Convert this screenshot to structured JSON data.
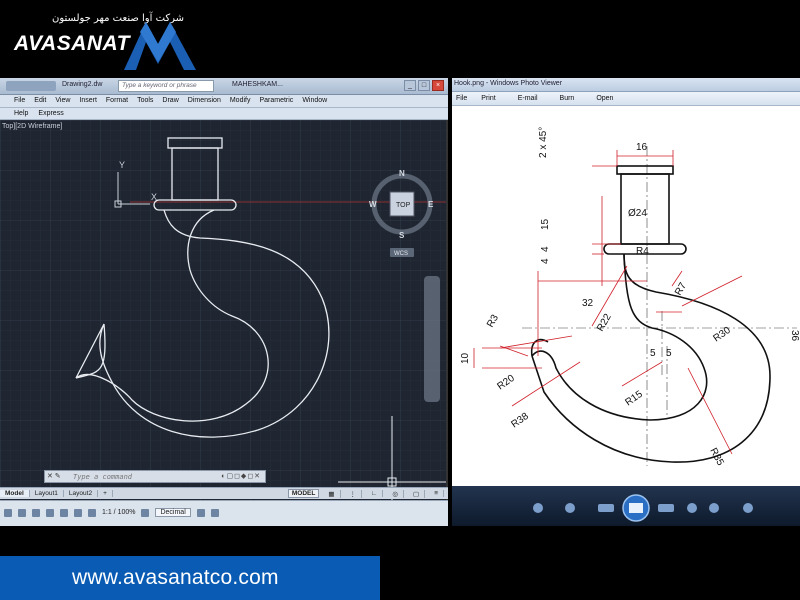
{
  "logo": {
    "persian": "شرکت آوا صنعت مهر جولستون",
    "word": "AVASANAT"
  },
  "autocad": {
    "doc_tab": "Drawing2.dw",
    "search_placeholder": "Type a keyword or phrase",
    "user": "MAHESHKAM...",
    "menu": [
      "File",
      "Edit",
      "View",
      "Insert",
      "Format",
      "Tools",
      "Draw",
      "Dimension",
      "Modify",
      "Parametric",
      "Window"
    ],
    "menu2": [
      "Help",
      "Express"
    ],
    "viewport_label": "Top][2D Wireframe]",
    "viewcube": {
      "top": "TOP",
      "n": "N",
      "s": "S",
      "e": "E",
      "w": "W",
      "wcs": "WCS"
    },
    "ucs": {
      "x": "X",
      "y": "Y"
    },
    "command_placeholder": "Type a command",
    "layout_tabs": [
      "Model",
      "Layout1",
      "Layout2",
      "+"
    ],
    "status_model": "MODEL",
    "status_scale": "1:1 / 100%",
    "status_units": "Decimal"
  },
  "viewer": {
    "title": "Hook.png - Windows Photo Viewer",
    "menu": [
      "File",
      "Print",
      "E-mail",
      "Burn",
      "Open"
    ],
    "dims": {
      "chamfer": "2 x 45°",
      "w16": "16",
      "d24": "Ø24",
      "h15": "15",
      "h4a": "4",
      "h4b": "4",
      "r4": "R4",
      "r7": "R7",
      "w32": "32",
      "r22": "R22",
      "r3": "R3",
      "r30": "R30",
      "h36": "36",
      "h10": "10",
      "r20": "R20",
      "w5a": "5",
      "w5b": "5",
      "r15": "R15",
      "r38": "R38",
      "r35": "R35"
    }
  },
  "footer": {
    "url": "www.avasanatco.com"
  },
  "colors": {
    "autocad_bg": "#1f2631",
    "footer_bg": "#0a5bb3",
    "dim_red": "#d0202a"
  }
}
